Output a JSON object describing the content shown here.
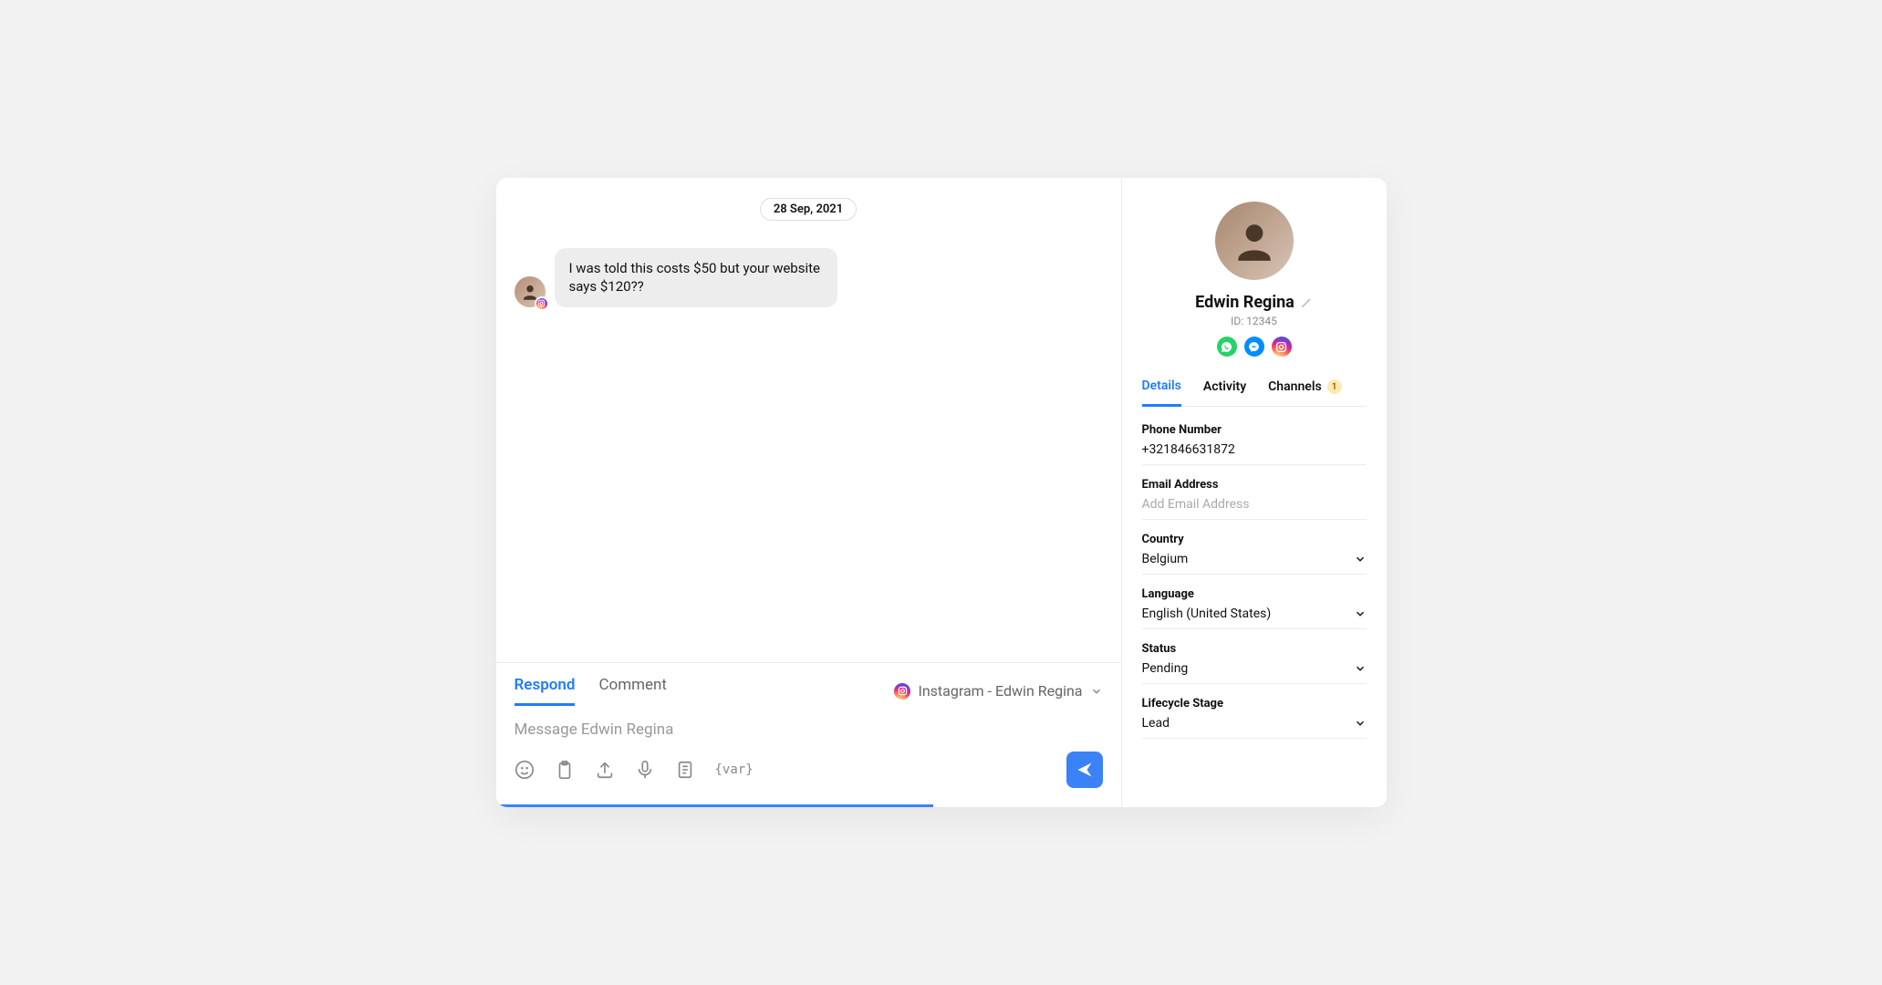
{
  "chat": {
    "date_stamp": "28 Sep, 2021",
    "message": "I was told this costs $50 but your website says $120??",
    "channel_badge": "instagram"
  },
  "composer": {
    "tab_respond": "Respond",
    "tab_comment": "Comment",
    "channel_label": "Instagram - Edwin Regina",
    "placeholder": "Message Edwin Regina",
    "var_icon_text": "{var}"
  },
  "contact": {
    "name": "Edwin Regina",
    "id_prefix": "ID: ",
    "id_value": "12345",
    "tabs": {
      "details": "Details",
      "activity": "Activity",
      "channels": "Channels",
      "channels_badge": "1"
    },
    "fields": {
      "phone": {
        "label": "Phone Number",
        "value": "+321846631872"
      },
      "email": {
        "label": "Email Address",
        "placeholder": "Add Email Address"
      },
      "country": {
        "label": "Country",
        "value": "Belgium"
      },
      "language": {
        "label": "Language",
        "value": "English (United States)"
      },
      "status": {
        "label": "Status",
        "value": "Pending"
      },
      "lifecycle": {
        "label": "Lifecycle Stage",
        "value": "Lead"
      }
    }
  }
}
